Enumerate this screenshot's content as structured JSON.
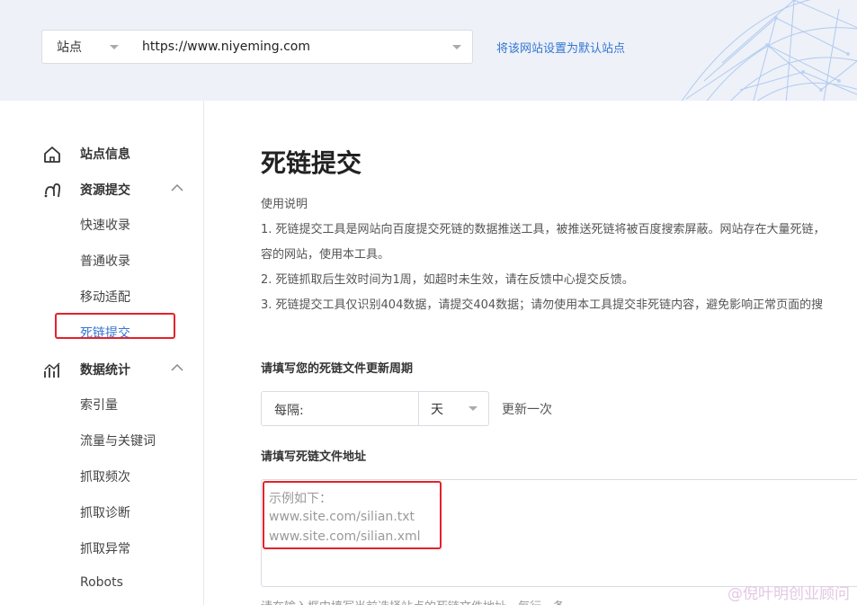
{
  "header": {
    "site_label": "站点",
    "site_url": "https://www.niyeming.com",
    "set_default_link": "将该网站设置为默认站点"
  },
  "sidebar": {
    "site_info": "站点信息",
    "resource_submit": {
      "label": "资源提交",
      "items": [
        "快速收录",
        "普通收录",
        "移动适配",
        "死链提交"
      ]
    },
    "data_stats": {
      "label": "数据统计",
      "items": [
        "索引量",
        "流量与关键词",
        "抓取频次",
        "抓取诊断",
        "抓取异常",
        "Robots"
      ]
    },
    "active_item": "死链提交"
  },
  "main": {
    "title": "死链提交",
    "usage_title": "使用说明",
    "usage_lines": [
      "1. 死链提交工具是网站向百度提交死链的数据推送工具，被推送死链将被百度搜索屏蔽。网站存在大量死链，",
      "容的网站，使用本工具。",
      "2. 死链抓取后生效时间为1周，如超时未生效，请在反馈中心提交反馈。",
      "3. 死链提交工具仅识别404数据，请提交404数据；请勿使用本工具提交非死链内容，避免影响正常页面的搜"
    ],
    "period_label": "请填写您的死链文件更新周期",
    "every_label": "每隔:",
    "period_unit": "天",
    "update_once": "更新一次",
    "address_label": "请填写死链文件地址",
    "example_lines": [
      "示例如下：",
      "www.site.com/silian.txt",
      "www.site.com/silian.xml"
    ],
    "bottom_hint": "请在输入框中填写当前选择站点的死链文件地址，每行一条"
  },
  "watermark": "@倪叶明创业顾问",
  "colors": {
    "accent": "#3476d2",
    "highlight": "#e4222b",
    "header_bg": "#eef1f8"
  }
}
